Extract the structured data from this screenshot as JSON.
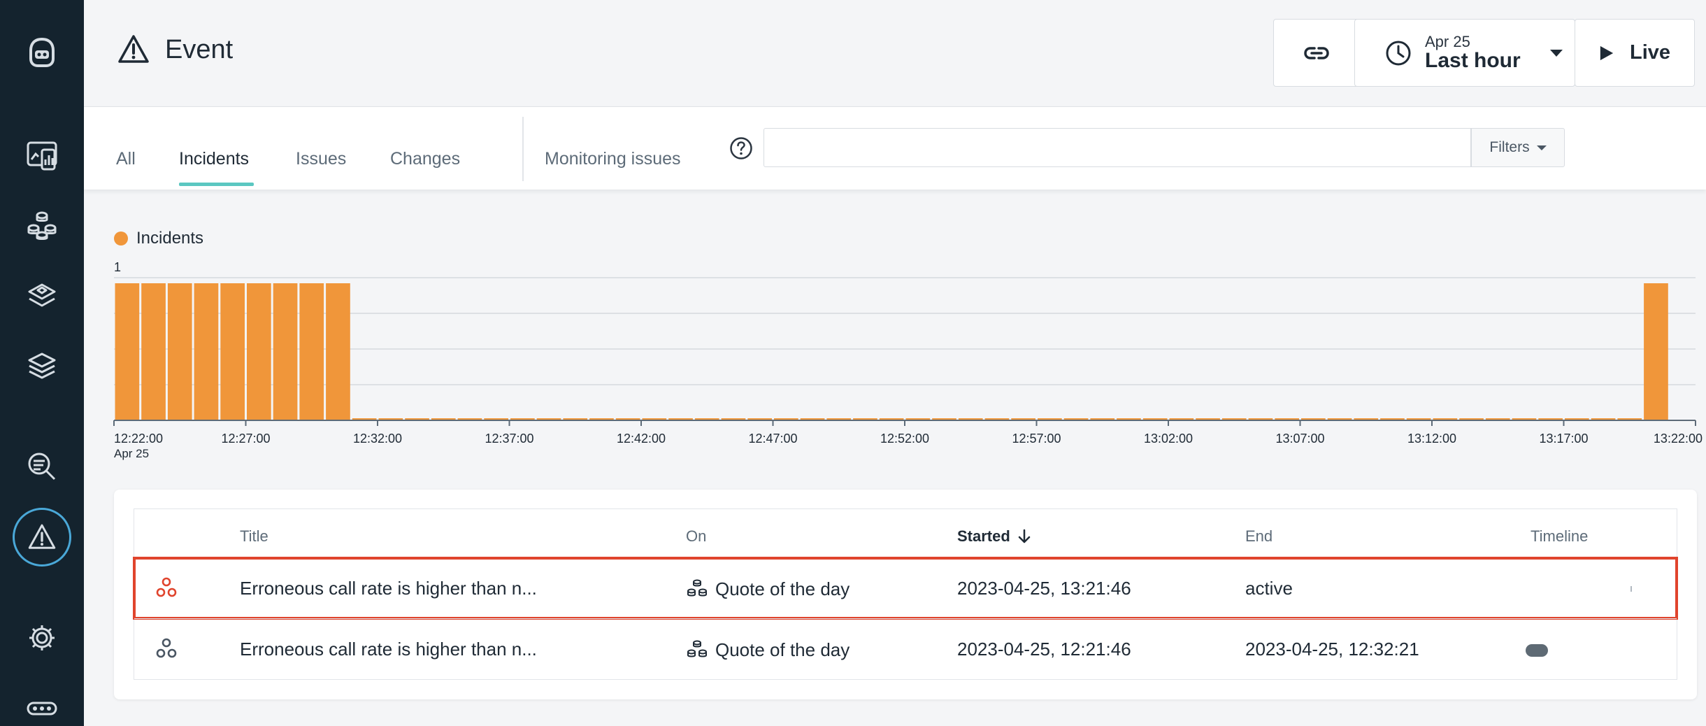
{
  "sidebar": {
    "items": [
      {
        "icon": "robot-logo-icon"
      },
      {
        "icon": "dashboard-icon"
      },
      {
        "icon": "services-icon"
      },
      {
        "icon": "stacks-icon"
      },
      {
        "icon": "layers-icon"
      },
      {
        "icon": "search-analysis-icon"
      },
      {
        "icon": "warning-icon",
        "active": true
      },
      {
        "icon": "gear-icon"
      },
      {
        "icon": "more-icon"
      }
    ]
  },
  "header": {
    "title": "Event",
    "time": {
      "date": "Apr 25",
      "range": "Last hour"
    },
    "live_label": "Live"
  },
  "tabs": {
    "items": [
      "All",
      "Incidents",
      "Issues",
      "Changes",
      "Monitoring issues"
    ],
    "active": "Incidents",
    "filters_label": "Filters",
    "search_value": ""
  },
  "colors": {
    "accent": "#5bc7c1",
    "incident": "#f0963a",
    "alert": "#e0442d"
  },
  "chart_data": {
    "type": "bar",
    "legend": "Incidents",
    "ylim": [
      0,
      1
    ],
    "y_ticks": [
      "1"
    ],
    "x_ticks": [
      "12:22:00",
      "12:27:00",
      "12:32:00",
      "12:37:00",
      "12:42:00",
      "12:47:00",
      "12:52:00",
      "12:57:00",
      "13:02:00",
      "13:07:00",
      "13:12:00",
      "13:17:00",
      "13:22:00"
    ],
    "x_sublabel": "Apr 25",
    "bin_minutes": 1,
    "values": [
      1,
      1,
      1,
      1,
      1,
      1,
      1,
      1,
      1,
      0,
      0,
      0,
      0,
      0,
      0,
      0,
      0,
      0,
      0,
      0,
      0,
      0,
      0,
      0,
      0,
      0,
      0,
      0,
      0,
      0,
      0,
      0,
      0,
      0,
      0,
      0,
      0,
      0,
      0,
      0,
      0,
      0,
      0,
      0,
      0,
      0,
      0,
      0,
      0,
      0,
      0,
      0,
      0,
      0,
      0,
      0,
      0,
      0,
      1
    ]
  },
  "table": {
    "headers": {
      "title": "Title",
      "on": "On",
      "started": "Started",
      "end": "End",
      "timeline": "Timeline"
    },
    "rows": [
      {
        "title": "Erroneous call rate is higher than n...",
        "on": "Quote of the day",
        "started": "2023-04-25, 13:21:46",
        "end": "active",
        "status": "open"
      },
      {
        "title": "Erroneous call rate is higher than n...",
        "on": "Quote of the day",
        "started": "2023-04-25, 12:21:46",
        "end": "2023-04-25, 12:32:21",
        "status": "closed"
      }
    ]
  }
}
